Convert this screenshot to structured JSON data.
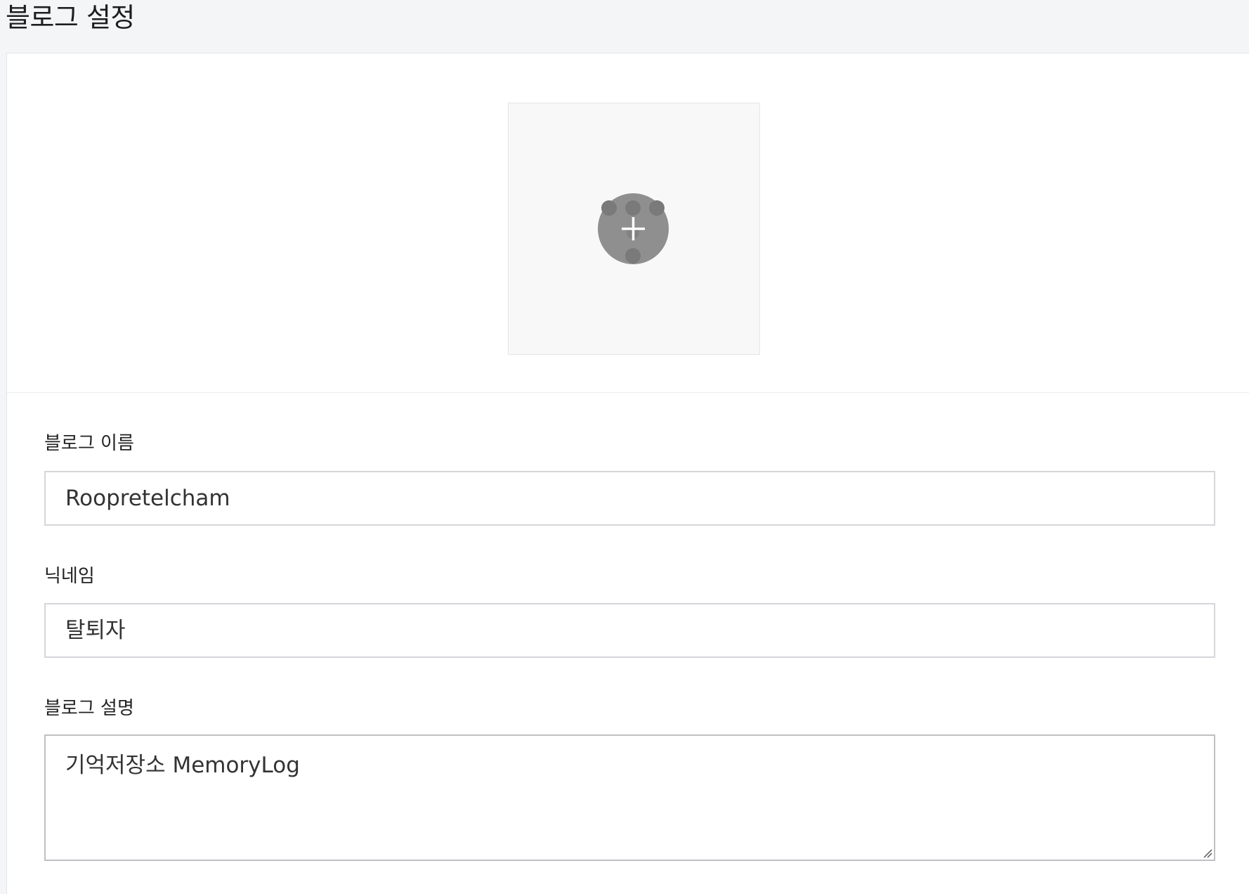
{
  "page": {
    "title": "블로그 설정"
  },
  "profile_image": {
    "add_icon": "plus-icon",
    "button_color": "#8f8f8f"
  },
  "form": {
    "blog_name": {
      "label": "블로그 이름",
      "value": "Roopretelcham"
    },
    "nickname": {
      "label": "닉네임",
      "value": "탈퇴자"
    },
    "description": {
      "label": "블로그 설명",
      "value": "기억저장소 MemoryLog"
    }
  }
}
